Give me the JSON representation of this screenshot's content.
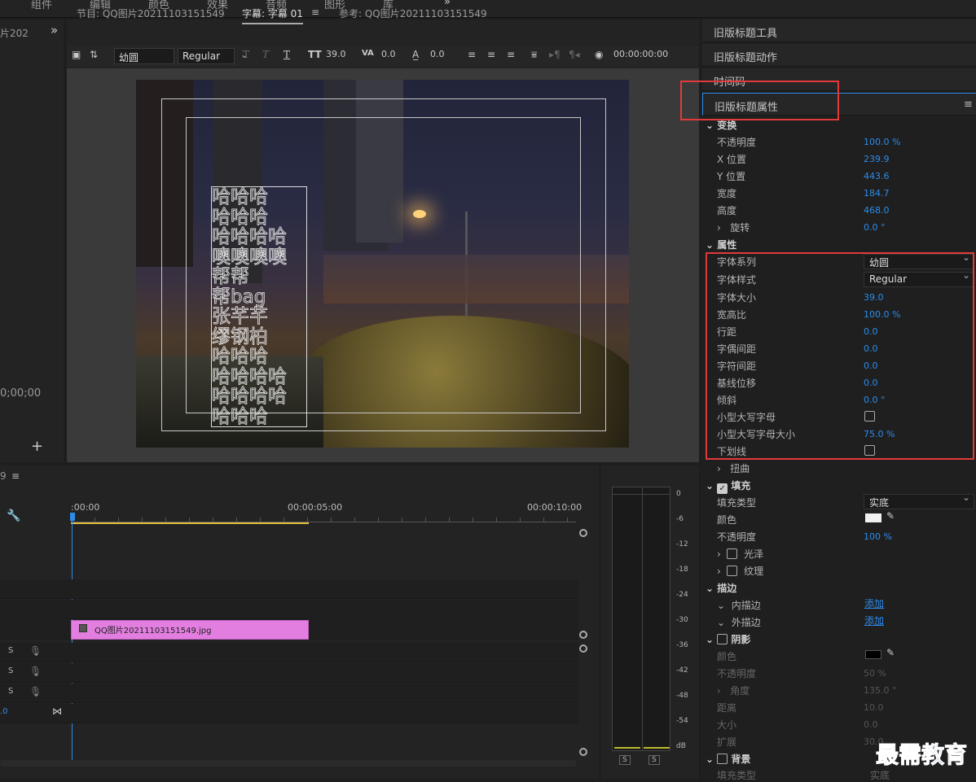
{
  "top_menu": [
    "组件",
    "编辑",
    "颜色",
    "效果",
    "音频",
    "图形",
    "库"
  ],
  "left_panel": {
    "title": "片202",
    "timecode": "0;00;00"
  },
  "tabs": {
    "program": "节目: QQ图片20211103151549",
    "caption": "字幕: 字幕 01",
    "reference": "参考: QQ图片20211103151549"
  },
  "toolbar": {
    "font": "幼圆",
    "style": "Regular",
    "font_size": "39.0",
    "kerning": "0.0",
    "leading": "0.0",
    "timecode": "00:00:00:00"
  },
  "canvas_text": [
    "哈哈哈",
    "哈哈哈",
    "哈哈哈哈",
    "噢噢噢噢",
    "帮帮",
    "帮bag",
    "张芊芊",
    "缪钢柏",
    "哈哈哈",
    "哈哈哈哈",
    "哈哈哈哈",
    "哈哈哈"
  ],
  "right_panel": {
    "headers": [
      "旧版标题工具",
      "旧版标题动作",
      "时间码",
      "旧版标题属性"
    ],
    "transform": {
      "title": "变换",
      "rows": [
        {
          "label": "不透明度",
          "value": "100.0 %"
        },
        {
          "label": "X 位置",
          "value": "239.9"
        },
        {
          "label": "Y 位置",
          "value": "443.6"
        },
        {
          "label": "宽度",
          "value": "184.7"
        },
        {
          "label": "高度",
          "value": "468.0"
        },
        {
          "label": "旋转",
          "value": "0.0 °"
        }
      ]
    },
    "properties": {
      "title": "属性",
      "font_family_label": "字体系列",
      "font_family": "幼圆",
      "font_style_label": "字体样式",
      "font_style": "Regular",
      "rows": [
        {
          "label": "字体大小",
          "value": "39.0"
        },
        {
          "label": "宽高比",
          "value": "100.0 %"
        },
        {
          "label": "行距",
          "value": "0.0"
        },
        {
          "label": "字偶间距",
          "value": "0.0"
        },
        {
          "label": "字符间距",
          "value": "0.0"
        },
        {
          "label": "基线位移",
          "value": "0.0"
        },
        {
          "label": "倾斜",
          "value": "0.0 °"
        }
      ],
      "small_caps": "小型大写字母",
      "small_caps_size_label": "小型大写字母大小",
      "small_caps_size": "75.0 %",
      "underline": "下划线",
      "distort": "扭曲"
    },
    "fill": {
      "title": "填充",
      "type_label": "填充类型",
      "type": "实底",
      "color_label": "颜色",
      "opacity_label": "不透明度",
      "opacity": "100 %",
      "sheen": "光泽",
      "texture": "纹理"
    },
    "stroke": {
      "title": "描边",
      "inner": "内描边",
      "outer": "外描边",
      "add": "添加"
    },
    "shadow": {
      "title": "阴影",
      "color": "颜色",
      "opacity_label": "不透明度",
      "opacity": "50 %",
      "angle_label": "角度",
      "angle": "135.0 °",
      "distance_label": "距离",
      "distance": "10.0",
      "size_label": "大小",
      "size": "0.0",
      "spread_label": "扩展",
      "spread": "30.0"
    },
    "background": {
      "title": "背景",
      "type_label": "填充类型",
      "type": "实底"
    }
  },
  "timeline": {
    "t0": ":00:00",
    "t5": "00:00:05:00",
    "t10": "00:00:10:00",
    "clip": "QQ图片20211103151549.jpg",
    "track_s": "S",
    "small_num": "9",
    "track_val": ".0"
  },
  "meter_scale": [
    "0",
    "-6",
    "-12",
    "-18",
    "-24",
    "-30",
    "-36",
    "-42",
    "-48",
    "-54",
    "dB"
  ],
  "meter_s": "S",
  "watermark": "最需教育",
  "accent_color": "#2d8ceb",
  "highlight_color": "#e23a3a"
}
